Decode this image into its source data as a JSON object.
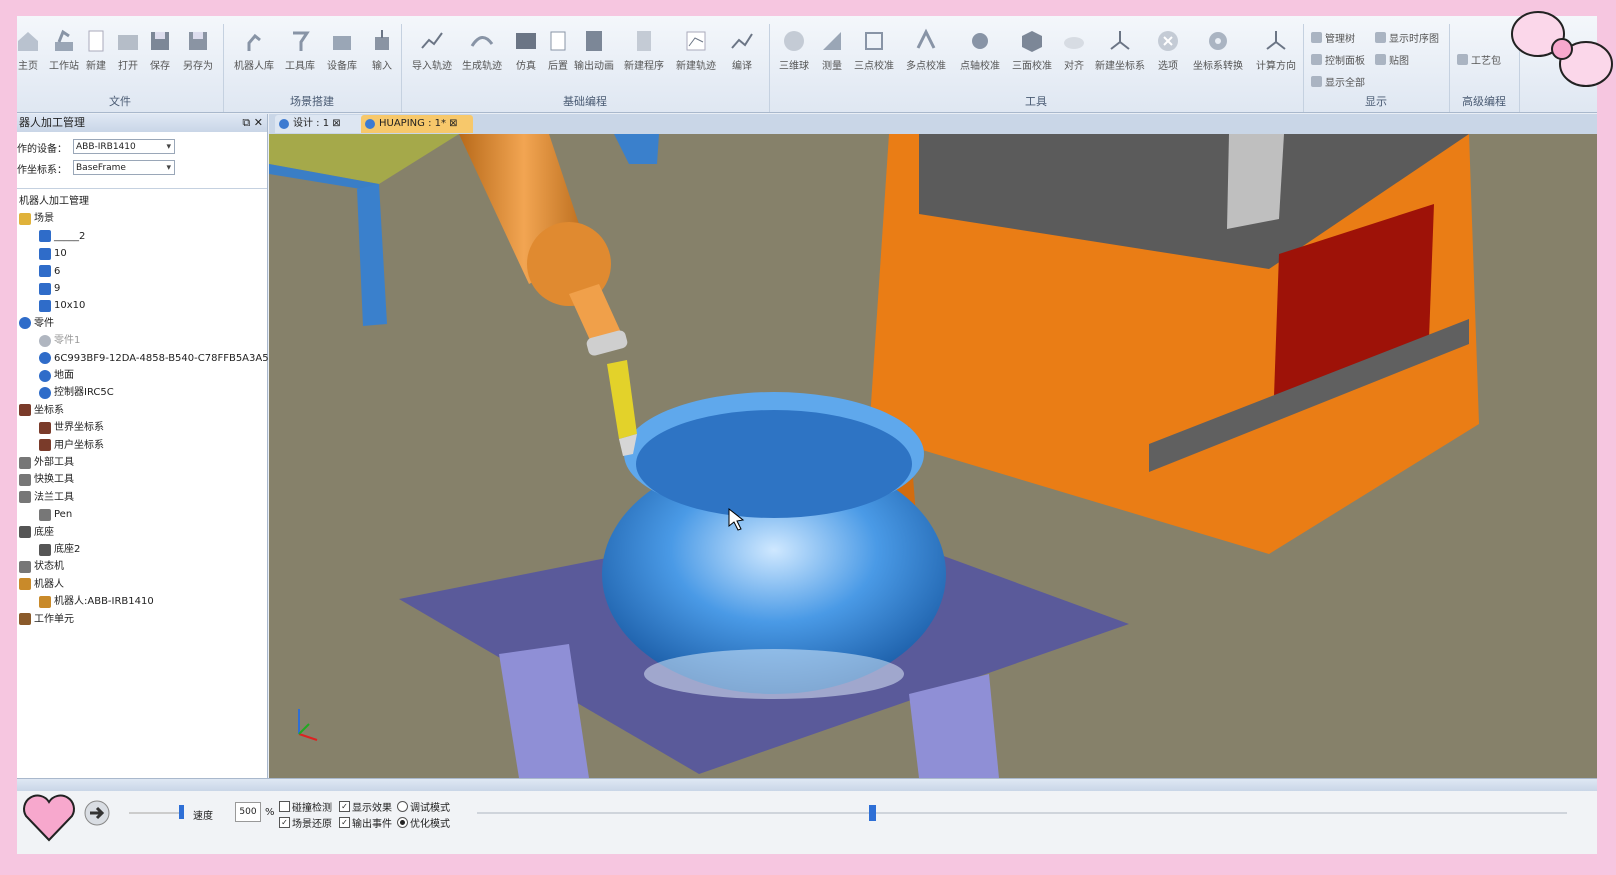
{
  "ribbon": {
    "groups": [
      {
        "title": "文件",
        "tools": [
          "主页",
          "工作站",
          "新建",
          "打开",
          "保存",
          "另存为"
        ]
      },
      {
        "title": "场景搭建",
        "tools": [
          "机器人库",
          "工具库",
          "设备库",
          "输入"
        ]
      },
      {
        "title": "基础编程",
        "tools": [
          "导入轨迹",
          "生成轨迹",
          "仿真",
          "后置",
          "输出动画",
          "新建程序",
          "新建轨迹",
          "编译"
        ]
      },
      {
        "title": "工具",
        "tools": [
          "三维球",
          "测量",
          "三点校准",
          "多点校准",
          "点轴校准",
          "三面校准",
          "对齐",
          "新建坐标系",
          "选项",
          "坐标系转换",
          "计算方向"
        ]
      },
      {
        "title": "显示",
        "tools": [
          "管理树",
          "显示时序图",
          "控制面板",
          "贴图",
          "显示全部"
        ]
      },
      {
        "title": "高级编程",
        "tools": [
          "工艺包"
        ]
      }
    ]
  },
  "panel": {
    "title": "器人加工管理",
    "device_label": "作的设备：",
    "device_value": "ABB-IRB1410",
    "frame_label": "作坐标系：",
    "frame_value": "BaseFrame",
    "tree": [
      {
        "label": "机器人加工管理",
        "indent": 0,
        "icon": "none"
      },
      {
        "label": "场景",
        "indent": 0,
        "icon": "scene-icon"
      },
      {
        "label": "_____2",
        "indent": 2,
        "icon": "cube-icon"
      },
      {
        "label": "10",
        "indent": 2,
        "icon": "cube-icon"
      },
      {
        "label": "6",
        "indent": 2,
        "icon": "cube-icon"
      },
      {
        "label": "9",
        "indent": 2,
        "icon": "cube-icon"
      },
      {
        "label": "10x10",
        "indent": 2,
        "icon": "cube-icon"
      },
      {
        "label": "零件",
        "indent": 0,
        "icon": "gear-icon"
      },
      {
        "label": "零件1",
        "indent": 2,
        "icon": "gear-gray-icon"
      },
      {
        "label": "6C993BF9-12DA-4858-B540-C78FFB5A3A5C",
        "indent": 2,
        "icon": "gear-icon"
      },
      {
        "label": "地面",
        "indent": 2,
        "icon": "gear-icon"
      },
      {
        "label": "控制器IRC5C",
        "indent": 2,
        "icon": "gear-icon"
      },
      {
        "label": "坐标系",
        "indent": 0,
        "icon": "axis-icon"
      },
      {
        "label": "世界坐标系",
        "indent": 2,
        "icon": "axis-icon"
      },
      {
        "label": "用户坐标系",
        "indent": 2,
        "icon": "axis-icon"
      },
      {
        "label": "外部工具",
        "indent": 0,
        "icon": "tool-icon"
      },
      {
        "label": "快换工具",
        "indent": 0,
        "icon": "tool-icon"
      },
      {
        "label": "法兰工具",
        "indent": 0,
        "icon": "tool-icon"
      },
      {
        "label": "Pen",
        "indent": 2,
        "icon": "tool-icon"
      },
      {
        "label": "底座",
        "indent": 0,
        "icon": "base-icon"
      },
      {
        "label": "底座2",
        "indent": 2,
        "icon": "base-icon"
      },
      {
        "label": "状态机",
        "indent": 0,
        "icon": "state-icon"
      },
      {
        "label": "机器人",
        "indent": 0,
        "icon": "robot-icon"
      },
      {
        "label": "机器人:ABB-IRB1410",
        "indent": 2,
        "icon": "robot-icon"
      },
      {
        "label": "工作单元",
        "indent": 0,
        "icon": "cell-icon"
      }
    ]
  },
  "tabs": [
    {
      "label": "设计 : 1",
      "active": false
    },
    {
      "label": "HUAPING : 1*",
      "active": true
    }
  ],
  "bottom": {
    "speed_label": "速度",
    "speed_value": "500",
    "percent": "%",
    "collision": "碰撞检测",
    "show_effect": "显示效果",
    "debug_mode": "调试模式",
    "scene_restore": "场景还原",
    "output_event": "输出事件",
    "optimize_mode": "优化模式",
    "timeline_progress": 0.36
  },
  "colors": {
    "part_blue": "#3f8fdc",
    "machine_orange": "#ee7d16",
    "floor": "#86816a"
  }
}
